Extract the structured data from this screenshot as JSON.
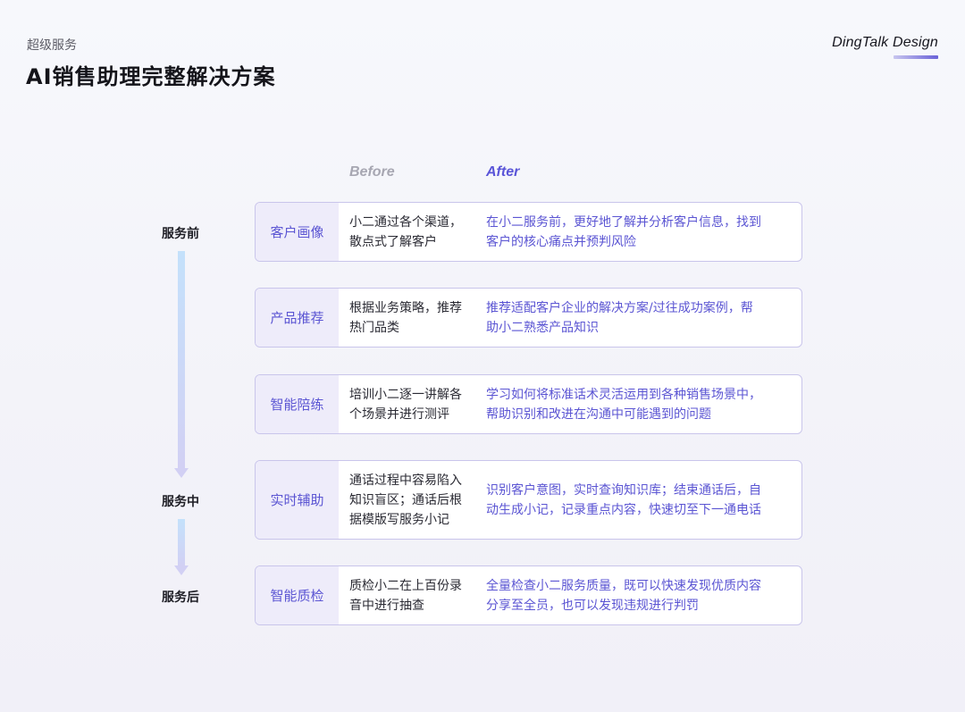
{
  "header": {
    "subtitle": "超级服务",
    "title": "AI销售助理完整解决方案",
    "brand": "DingTalk Design"
  },
  "columns": {
    "before": "Before",
    "after": "After"
  },
  "stages": [
    "服务前",
    "服务中",
    "服务后"
  ],
  "rows": [
    {
      "label": "客户画像",
      "before": "小二通过各个渠道，\n散点式了解客户",
      "after": "在小二服务前，更好地了解并分析客户信息，找到\n客户的核心痛点并预判风险"
    },
    {
      "label": "产品推荐",
      "before": "根据业务策略，推荐\n热门品类",
      "after": "推荐适配客户企业的解决方案/过往成功案例，帮\n助小二熟悉产品知识"
    },
    {
      "label": "智能陪练",
      "before": "培训小二逐一讲解各\n个场景并进行测评",
      "after": "学习如何将标准话术灵活运用到各种销售场景中，\n帮助识别和改进在沟通中可能遇到的问题"
    },
    {
      "label": "实时辅助",
      "before": "通话过程中容易陷入\n知识盲区；通话后根\n据模版写服务小记",
      "after": "识别客户意图，实时查询知识库；结束通话后，自\n动生成小记，记录重点内容，快速切至下一通电话"
    },
    {
      "label": "智能质检",
      "before": "质检小二在上百份录\n音中进行抽查",
      "after": "全量检查小二服务质量，既可以快速发现优质内容\n分享至全员，也可以发现违规进行判罚"
    }
  ]
}
